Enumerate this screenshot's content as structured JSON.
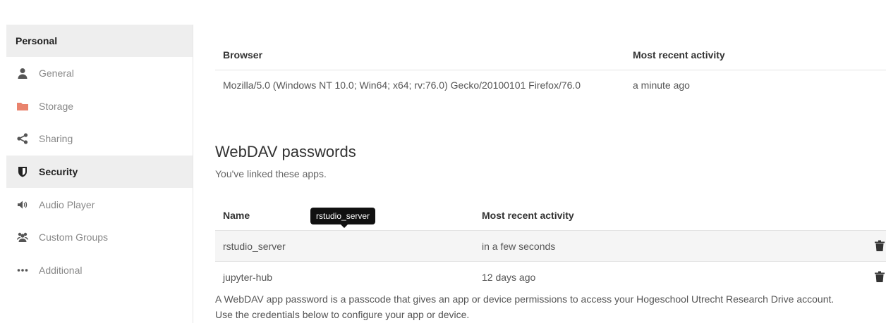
{
  "sidebar": {
    "header": "Personal",
    "items": [
      {
        "label": "General",
        "icon": "user-icon"
      },
      {
        "label": "Storage",
        "icon": "folder-icon"
      },
      {
        "label": "Sharing",
        "icon": "share-icon"
      },
      {
        "label": "Security",
        "icon": "shield-icon"
      },
      {
        "label": "Audio Player",
        "icon": "speaker-icon"
      },
      {
        "label": "Custom Groups",
        "icon": "group-icon"
      },
      {
        "label": "Additional",
        "icon": "more-icon"
      }
    ],
    "active": "Security"
  },
  "sessions": {
    "headers": {
      "browser": "Browser",
      "activity": "Most recent activity"
    },
    "rows": [
      {
        "browser": "Mozilla/5.0 (Windows NT 10.0; Win64; x64; rv:76.0) Gecko/20100101 Firefox/76.0",
        "activity": "a minute ago"
      }
    ]
  },
  "webdav": {
    "title": "WebDAV passwords",
    "subtitle": "You've linked these apps.",
    "headers": {
      "name": "Name",
      "activity": "Most recent activity"
    },
    "rows": [
      {
        "name": "rstudio_server",
        "activity": "in a few seconds"
      },
      {
        "name": "jupyter-hub",
        "activity": "12 days ago"
      }
    ],
    "tooltip": "rstudio_server",
    "info_line1": "A WebDAV app password is a passcode that gives an app or device permissions to access your Hogeschool Utrecht Research Drive account.",
    "info_line2": "Use the credentials below to configure your app or device."
  },
  "colors": {
    "folder": "#e9836d",
    "active_bg": "#eeeeee",
    "tooltip_bg": "#111111"
  }
}
